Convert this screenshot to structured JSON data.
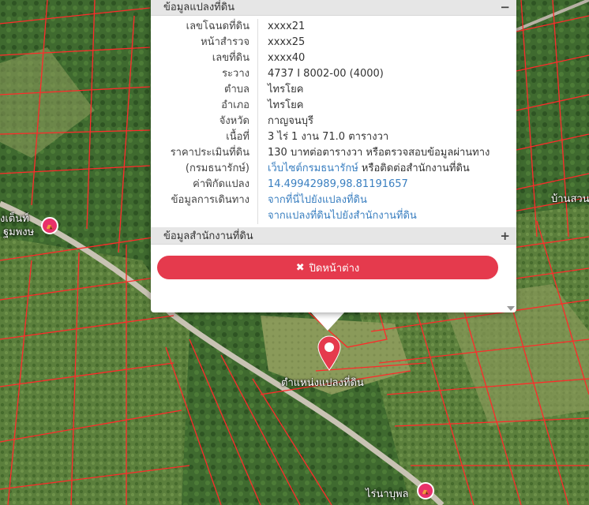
{
  "popup": {
    "section1_title": "ข้อมูลแปลงที่ดิน",
    "section1_toggle": "−",
    "rows": [
      {
        "label": "เลขโฉนดที่ดิน",
        "value": "xxxx21"
      },
      {
        "label": "หน้าสำรวจ",
        "value": "xxxx25"
      },
      {
        "label": "เลขที่ดิน",
        "value": "xxxx40"
      },
      {
        "label": "ระวาง",
        "value": "4737 I 8002-00 (4000)"
      },
      {
        "label": "ตำบล",
        "value": "ไทรโยค"
      },
      {
        "label": "อำเภอ",
        "value": "ไทรโยค"
      },
      {
        "label": "จังหวัด",
        "value": "กาญจนบุรี"
      },
      {
        "label": "เนื้อที่",
        "value": "3 ไร่ 1 งาน 71.0 ตารางวา"
      }
    ],
    "price_label": "ราคาประเมินที่ดิน",
    "price_value": "130 บาทต่อตารางวา หรือตรวจสอบข้อมูลผ่านทาง",
    "dept_label": "(กรมธนารักษ์)",
    "dept_link": "เว็บไซต์กรมธนารักษ์",
    "dept_rest": " หรือติดต่อสำนักงานที่ดิน",
    "coord_label": "ค่าพิกัดแปลง",
    "coord_value": "14.49942989,98.81191657",
    "travel_label": "ข้อมูลการเดินทาง",
    "travel_link1": "จากที่นี่ไปยังแปลงที่ดิน",
    "travel_link2": "จากแปลงที่ดินไปยังสำนักงานที่ดิน",
    "section2_title": "ข้อมูลสำนักงานที่ดิน",
    "section2_toggle": "+",
    "close_icon": "✖",
    "close_label": "ปิดหน้าต่าง"
  },
  "map": {
    "pin_label": "ตำแหน่งแปลงที่ดิน",
    "label_left": "งเต็นท์",
    "label_left2": "ฐมพงษ",
    "label_right": "บ้านสวน",
    "label_bottom": "ไร่นาบุพล",
    "poi_icon": "tent-icon",
    "pin_color": "#e53a4d",
    "parcel_color": "#ff2a2a"
  }
}
